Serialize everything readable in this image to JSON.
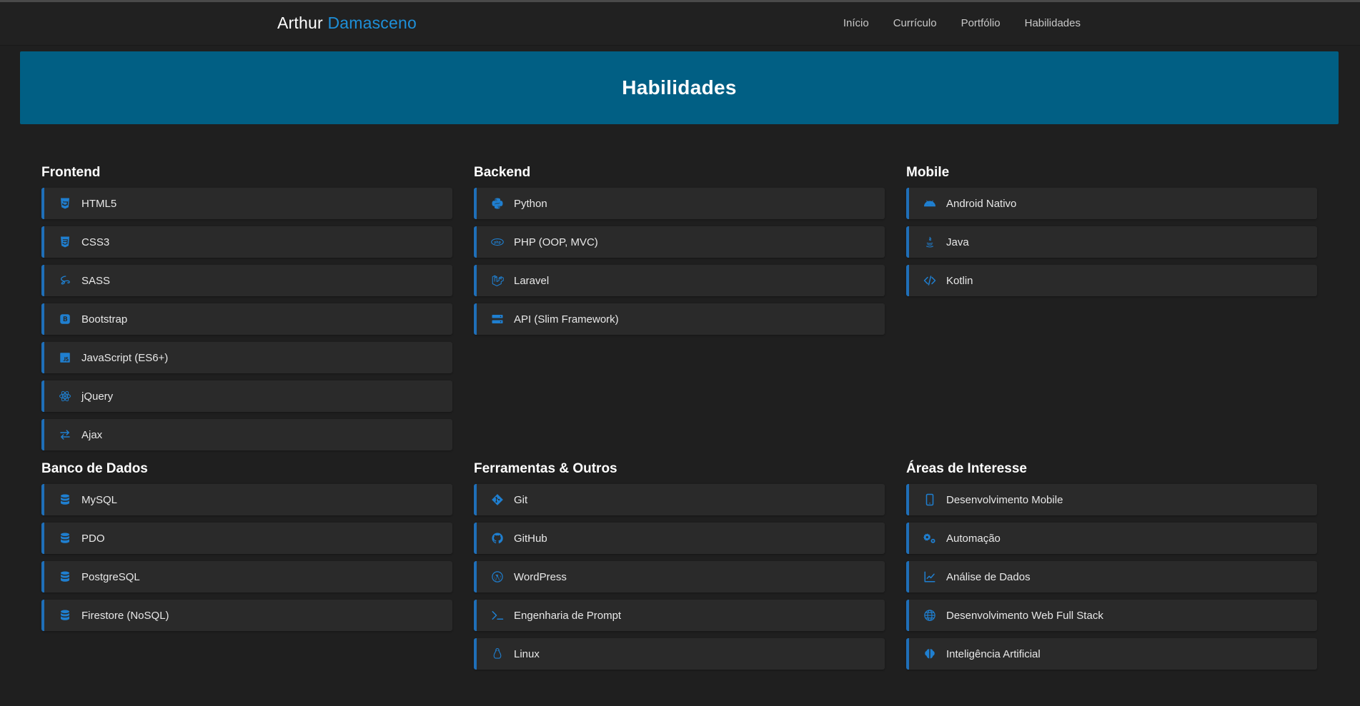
{
  "brand": {
    "first": "Arthur",
    "last": "Damasceno"
  },
  "nav": {
    "items": [
      "Início",
      "Currículo",
      "Portfólio",
      "Habilidades"
    ]
  },
  "hero": {
    "title": "Habilidades"
  },
  "colors": {
    "accent": "#1e8fd8",
    "hero_bg": "#015f84",
    "background": "#1f1f1f",
    "card_bg": "#2a2a2a"
  },
  "sections": [
    {
      "title": "Frontend",
      "items": [
        {
          "label": "HTML5",
          "icon": "html5-icon"
        },
        {
          "label": "CSS3",
          "icon": "css3-icon"
        },
        {
          "label": "SASS",
          "icon": "sass-icon"
        },
        {
          "label": "Bootstrap",
          "icon": "bootstrap-icon"
        },
        {
          "label": "JavaScript (ES6+)",
          "icon": "javascript-icon"
        },
        {
          "label": "jQuery",
          "icon": "react-icon"
        },
        {
          "label": "Ajax",
          "icon": "exchange-icon"
        }
      ]
    },
    {
      "title": "Backend",
      "items": [
        {
          "label": "Python",
          "icon": "python-icon"
        },
        {
          "label": "PHP (OOP, MVC)",
          "icon": "php-icon"
        },
        {
          "label": "Laravel",
          "icon": "laravel-icon"
        },
        {
          "label": "API (Slim Framework)",
          "icon": "server-icon"
        }
      ]
    },
    {
      "title": "Mobile",
      "items": [
        {
          "label": "Android Nativo",
          "icon": "android-icon"
        },
        {
          "label": "Java",
          "icon": "java-icon"
        },
        {
          "label": "Kotlin",
          "icon": "code-icon"
        }
      ]
    },
    {
      "title": "Banco de Dados",
      "items": [
        {
          "label": "MySQL",
          "icon": "database-icon"
        },
        {
          "label": "PDO",
          "icon": "database-icon"
        },
        {
          "label": "PostgreSQL",
          "icon": "database-icon"
        },
        {
          "label": "Firestore (NoSQL)",
          "icon": "database-icon"
        }
      ]
    },
    {
      "title": "Ferramentas & Outros",
      "items": [
        {
          "label": "Git",
          "icon": "git-icon"
        },
        {
          "label": "GitHub",
          "icon": "github-icon"
        },
        {
          "label": "WordPress",
          "icon": "wordpress-icon"
        },
        {
          "label": "Engenharia de Prompt",
          "icon": "terminal-icon"
        },
        {
          "label": "Linux",
          "icon": "linux-icon"
        }
      ]
    },
    {
      "title": "Áreas de Interesse",
      "items": [
        {
          "label": "Desenvolvimento Mobile",
          "icon": "mobile-icon"
        },
        {
          "label": "Automação",
          "icon": "cogs-icon"
        },
        {
          "label": "Análise de Dados",
          "icon": "chart-line-icon"
        },
        {
          "label": "Desenvolvimento Web Full Stack",
          "icon": "globe-icon"
        },
        {
          "label": "Inteligência Artificial",
          "icon": "brain-icon"
        }
      ]
    }
  ]
}
